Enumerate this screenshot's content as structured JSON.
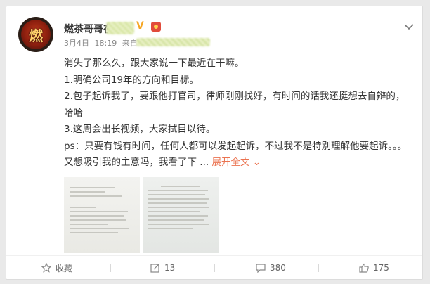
{
  "post": {
    "author": "燃茶哥哥在",
    "verified_mark": "V",
    "avatar_text": "燃",
    "date": "3月4日",
    "time": "18:19",
    "source_prefix": "来自",
    "paragraphs": [
      "消失了那么久，跟大家说一下最近在干嘛。",
      "1.明确公司19年的方向和目标。",
      "2.包子起诉我了，要跟他打官司，律师刚刚找好，有时间的话我还挺想去自辩的，哈哈",
      "3.这周会出长视频，大家拭目以待。",
      "ps：只要有钱有时间，任何人都可以发起起诉，不过我不是特别理解他要起诉。。。又想吸引我的主意吗，我看了下 ..."
    ],
    "expand_label": "展开全文"
  },
  "actions": {
    "favorite_label": "收藏",
    "repost_count": "13",
    "comment_count": "380",
    "like_count": "175"
  },
  "colors": {
    "accent": "#eb7350",
    "verified": "#f5a623"
  }
}
